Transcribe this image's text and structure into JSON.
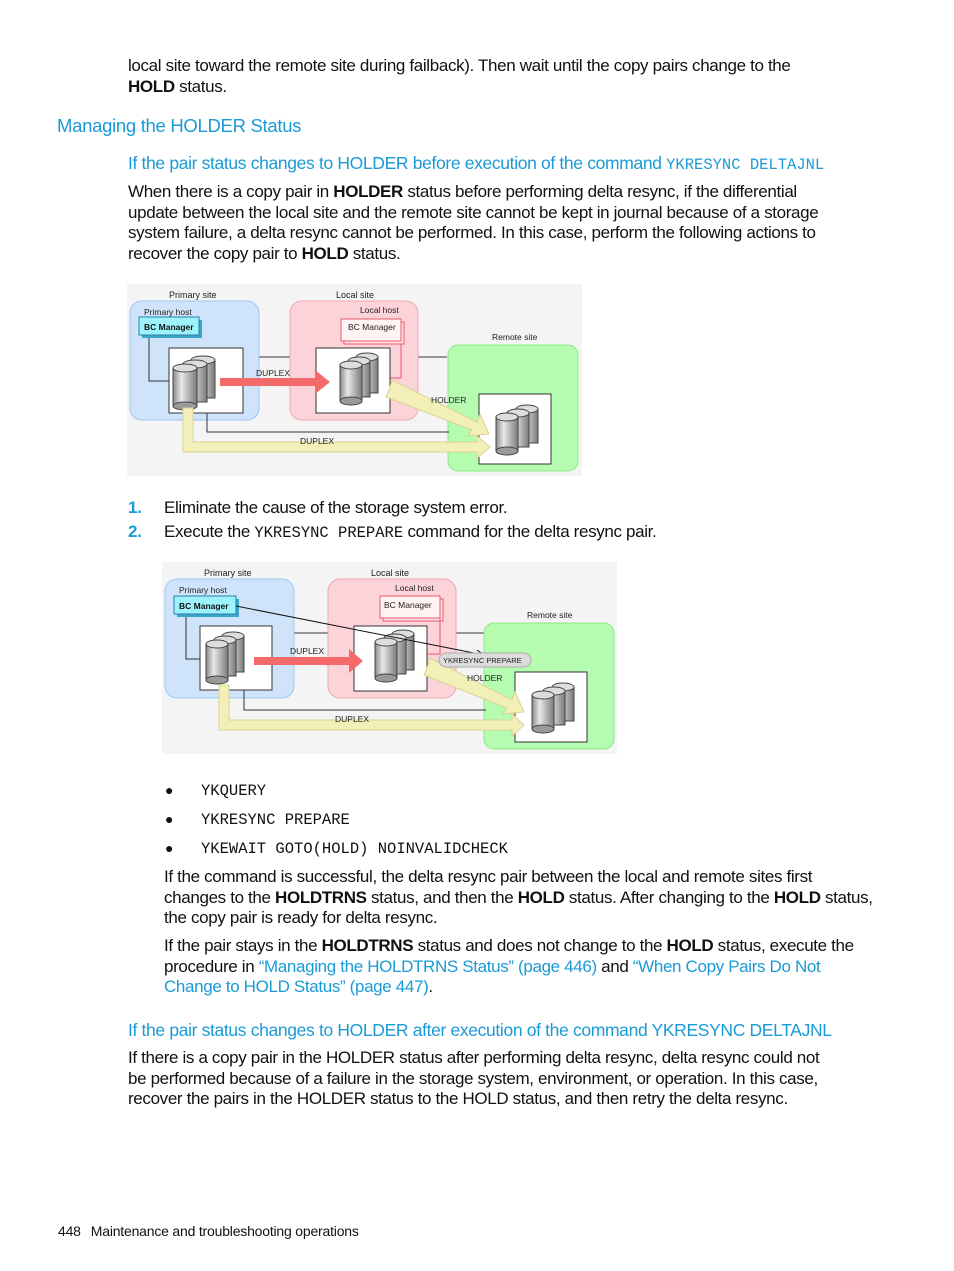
{
  "intro": {
    "line1": "local site toward the remote site during failback). Then wait until the copy pairs change to the",
    "bold1": "HOLD",
    "line2_rest": " status."
  },
  "section_heading": "Managing the HOLDER Status",
  "subsection1": {
    "heading_text": "If the pair status changes to HOLDER before execution of the command ",
    "heading_code": "YKRESYNC DELTAJNL",
    "para_lines": [
      [
        "When there is a copy pair in ",
        "HOLDER",
        " status before performing delta resync, if the differential"
      ],
      [
        "update between the local site and the remote site cannot be kept in journal because of a storage"
      ],
      [
        "system failure, a delta resync cannot be performed. In this case, perform the following actions to"
      ],
      [
        "recover the copy pair to ",
        "HOLD",
        " status."
      ]
    ]
  },
  "diagram1": {
    "primary_site": "Primary site",
    "primary_host": "Primary host",
    "bc_manager": "BC Manager",
    "local_site": "Local site",
    "local_host": "Local host",
    "local_bc_manager": "BC Manager",
    "remote_site": "Remote site",
    "duplex_top": "DUPLEX",
    "holder": "HOLDER",
    "duplex_bottom": "DUPLEX"
  },
  "steps": [
    {
      "num": "1.",
      "text": "Eliminate the cause of the storage system error."
    },
    {
      "num": "2.",
      "pre": "Execute the ",
      "code": "YKRESYNC PREPARE",
      "post": " command for the delta resync pair."
    }
  ],
  "diagram2": {
    "primary_site": "Primary site",
    "primary_host": "Primary host",
    "bc_manager": "BC Manager",
    "local_site": "Local site",
    "local_host": "Local host",
    "local_bc_manager": "BC Manager",
    "remote_site": "Remote site",
    "duplex_top": "DUPLEX",
    "command_bubble": "YKRESYNC PREPARE",
    "holder": "HOLDER",
    "duplex_bottom": "DUPLEX"
  },
  "commands": [
    "YKQUERY",
    "YKRESYNC PREPARE",
    "YKEWAIT GOTO(HOLD) NOINVALIDCHECK"
  ],
  "result_para": {
    "l1": "If the command is successful, the delta resync pair between the local and remote sites first",
    "l2a": "changes to the ",
    "l2b": "HOLDTRNS",
    "l2c": " status, and then the ",
    "l2d": "HOLD",
    "l2e": " status. After changing to the ",
    "l2f": "HOLD",
    "l2g": " status,",
    "l3": "the copy pair is ready for delta resync."
  },
  "stuck_para": {
    "l1a": "If the pair stays in the ",
    "l1b": "HOLDTRNS",
    "l1c": " status and does not change to the ",
    "l1d": "HOLD",
    "l1e": " status, execute the",
    "l2a": "procedure in ",
    "link1": "“Managing the HOLDTRNS Status” (page 446)",
    "l2b": " and ",
    "link2_part1": "“When Copy Pairs Do Not",
    "link2_part2": "Change to HOLD Status” (page 447)",
    "l3end": "."
  },
  "subsection2": {
    "heading": "If the pair status changes to HOLDER after execution of the command YKRESYNC DELTAJNL",
    "lines": [
      "If there is a copy pair in the HOLDER status after performing delta resync, delta resync could not",
      "be performed because of a failure in the storage system, environment, or operation. In this case,",
      "recover the pairs in the HOLDER status to the HOLD status, and then retry the delta resync."
    ]
  },
  "footer": {
    "page_number": "448",
    "chapter": "Maintenance and troubleshooting operations"
  },
  "colors": {
    "heading_blue": "#1a9ad6",
    "primary_site_fill": "#cfe4fb",
    "local_site_fill": "#fbd3d8",
    "remote_site_fill": "#b5fbb0",
    "duplex_arrow": "#f46a6a",
    "yellow_arrow": "#f2efb8",
    "bc_manager_fill": "#9df3fb"
  }
}
